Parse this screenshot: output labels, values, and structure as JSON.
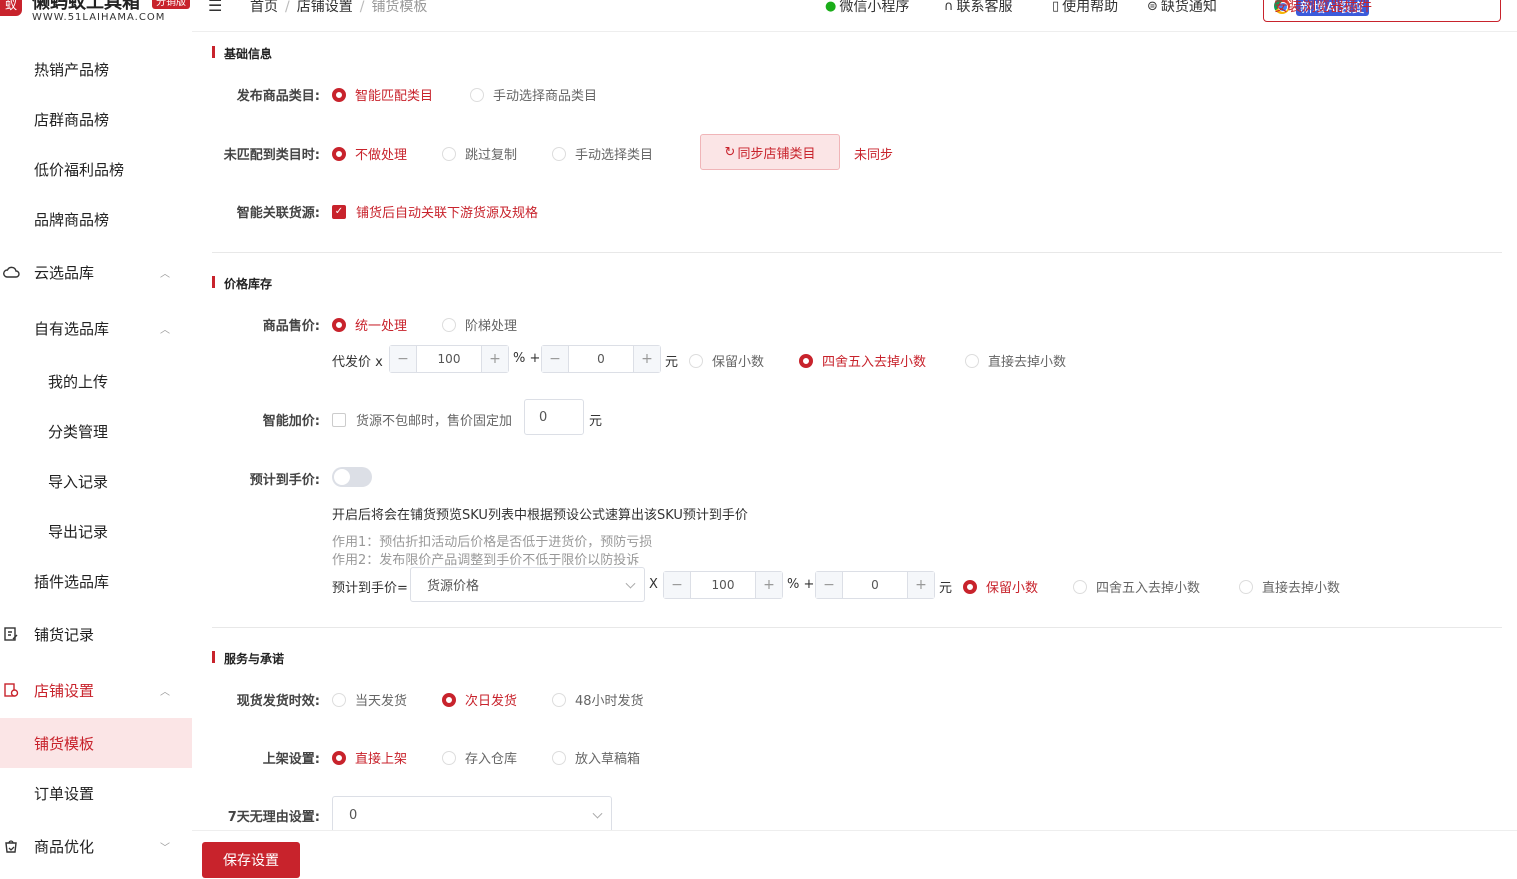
{
  "brand": {
    "title": "懒蚂蚁工具箱",
    "tag": "分销版",
    "url": "WWW.51LAIHAMA.COM",
    "accent_color": "#c8232c"
  },
  "sidebar": {
    "items": [
      {
        "label": "热销产品榜"
      },
      {
        "label": "店群商品榜"
      },
      {
        "label": "低价福利品榜"
      },
      {
        "label": "品牌商品榜"
      },
      {
        "label": "云选品库",
        "icon": "cloud-icon"
      },
      {
        "label": "自有选品库"
      },
      {
        "label": "我的上传"
      },
      {
        "label": "分类管理"
      },
      {
        "label": "导入记录"
      },
      {
        "label": "导出记录"
      },
      {
        "label": "插件选品库"
      },
      {
        "label": "铺货记录",
        "icon": "edit-record-icon"
      },
      {
        "label": "店铺设置",
        "icon": "store-settings-icon"
      },
      {
        "label": "铺货模板"
      },
      {
        "label": "订单设置"
      },
      {
        "label": "商品优化",
        "icon": "product-bag-icon"
      }
    ]
  },
  "header": {
    "breadcrumb": [
      "首页",
      "店铺设置",
      "铺货模板"
    ],
    "links": {
      "miniprogram": "微信小程序",
      "support": "联系客服",
      "help": "使用帮助",
      "stockout": "缺货通知"
    },
    "plugin_button": "安装浏览器插件",
    "plugin_badge": "新增AI裂变"
  },
  "basic": {
    "title": "基础信息",
    "category": {
      "label": "发布商品类目:",
      "options": [
        "智能匹配类目",
        "手动选择商品类目"
      ],
      "selected": 0
    },
    "unmatched": {
      "label": "未匹配到类目时:",
      "options": [
        "不做处理",
        "跳过复制",
        "手动选择类目"
      ],
      "selected": 0,
      "sync_button": "同步店铺类目",
      "sync_status": "未同步"
    },
    "source": {
      "label": "智能关联货源:",
      "checkbox": "铺货后自动关联下游货源及规格",
      "checked": true
    }
  },
  "price": {
    "title": "价格库存",
    "sale": {
      "label": "商品售价:",
      "options": [
        "统一处理",
        "阶梯处理"
      ],
      "selected": 0
    },
    "formula": {
      "prefix": "代发价 x",
      "percent": "100",
      "pct_sign": "% +",
      "plus": "0",
      "unit": "元",
      "rounding": [
        "保留小数",
        "四舍五入去掉小数",
        "直接去掉小数"
      ],
      "selected": 1
    },
    "smart_add": {
      "label": "智能加价:",
      "checkbox": "货源不包邮时，售价固定加",
      "checked": false,
      "value": "0",
      "unit": "元"
    },
    "expected": {
      "label": "预计到手价:",
      "enabled": false,
      "desc": "开启后将会在铺货预览SKU列表中根据预设公式速算出该SKU预计到手价",
      "note1": "作用1：预估折扣活动后价格是否低于进货价，预防亏损",
      "note2": "作用2：发布限价产品调整到手价不低于限价以防投诉",
      "formula_label": "预计到手价=",
      "base": "货源价格",
      "times": "X",
      "percent": "100",
      "pct_sign": "% +",
      "plus": "0",
      "unit": "元",
      "rounding": [
        "保留小数",
        "四舍五入去掉小数",
        "直接去掉小数"
      ],
      "selected": 0
    }
  },
  "service": {
    "title": "服务与承诺",
    "delivery": {
      "label": "现货发货时效:",
      "options": [
        "当天发货",
        "次日发货",
        "48小时发货"
      ],
      "selected": 1
    },
    "listing": {
      "label": "上架设置:",
      "options": [
        "直接上架",
        "存入仓库",
        "放入草稿箱"
      ],
      "selected": 0
    },
    "return": {
      "label": "7天无理由设置:",
      "value": "0"
    }
  },
  "footer": {
    "save": "保存设置"
  }
}
